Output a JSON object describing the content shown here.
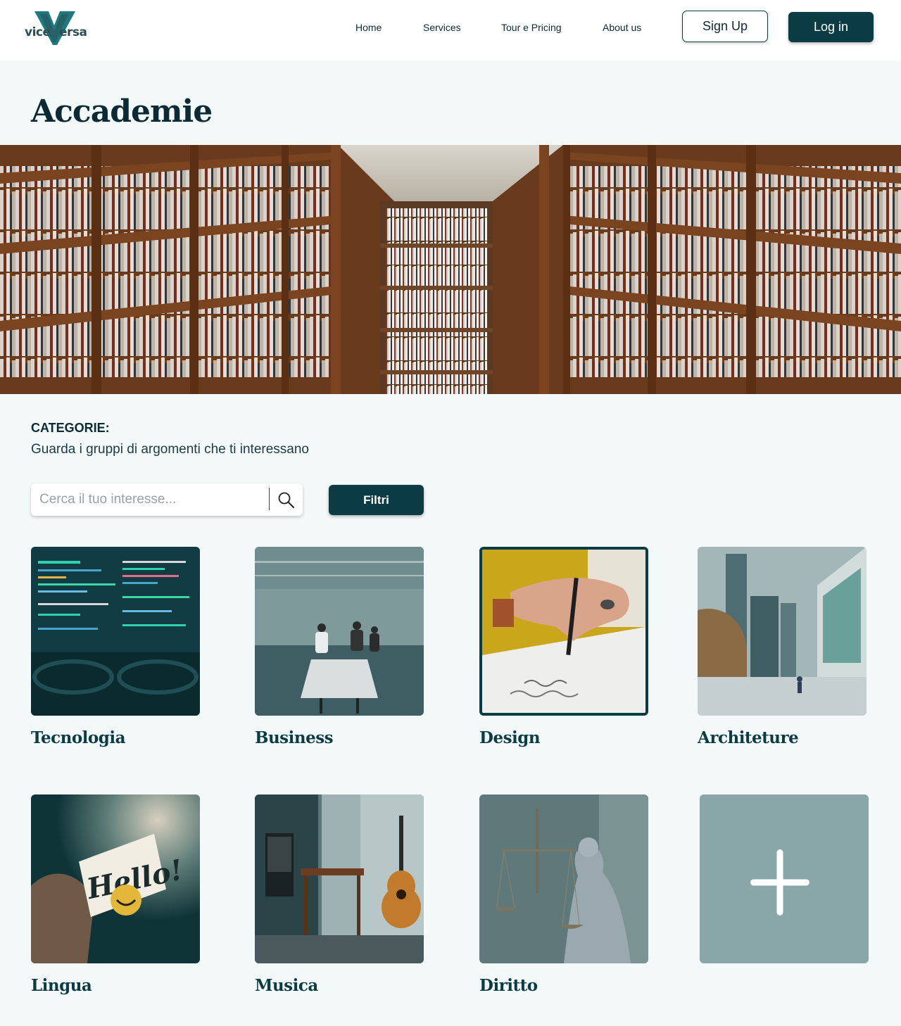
{
  "brand": {
    "logo_left": "vice",
    "logo_right": "ersa"
  },
  "nav": {
    "items": [
      "Home",
      "Services",
      "Tour e Pricing",
      "About us"
    ],
    "signup_label": "Sign Up",
    "login_label": "Log in"
  },
  "page": {
    "title": "Accademie"
  },
  "categories": {
    "heading": "CATEGORIE:",
    "subtitle": "Guarda i gruppi di argomenti che ti interessano",
    "search": {
      "placeholder": "Cerca il tuo interesse...",
      "value": ""
    },
    "filter_label": "Filtri",
    "items": [
      {
        "label": "Tecnologia",
        "selected": false
      },
      {
        "label": "Business",
        "selected": false
      },
      {
        "label": "Design",
        "selected": true
      },
      {
        "label": "Architeture",
        "selected": false
      },
      {
        "label": "Lingua",
        "selected": false
      },
      {
        "label": "Musica",
        "selected": false
      },
      {
        "label": "Diritto",
        "selected": false
      }
    ],
    "add_icon": "plus-icon"
  },
  "colors": {
    "primary": "#0b3c44",
    "background": "#f3f9f9",
    "add_tile": "#89a6a8"
  }
}
